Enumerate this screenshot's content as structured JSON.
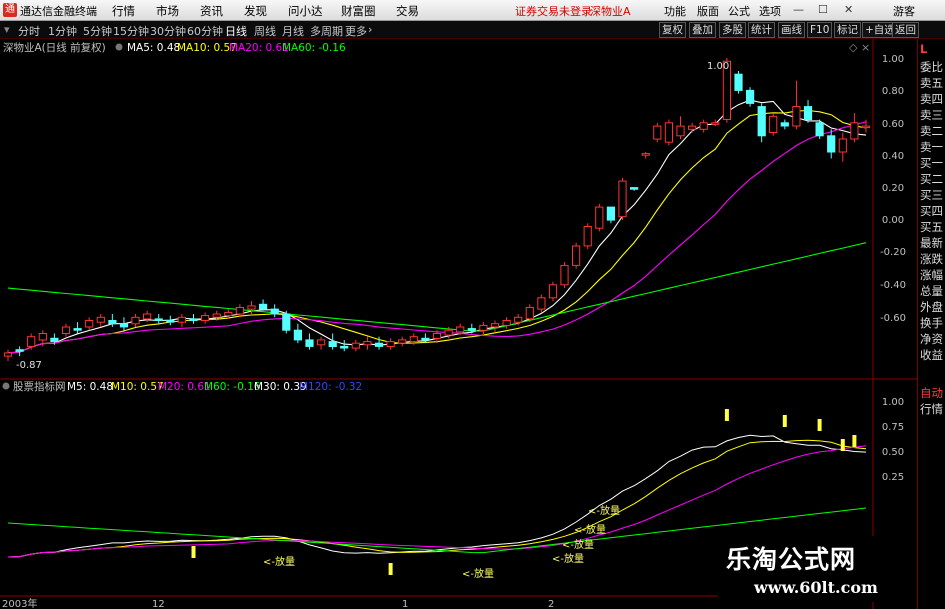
{
  "titlebar": {
    "logo_text": "通",
    "app_name": "通达信金融终端",
    "menus": [
      "行情",
      "市场",
      "资讯",
      "发现",
      "问小达",
      "财富圈",
      "交易"
    ],
    "status_warning": "证券交易未登录",
    "stock_title": "深物业A",
    "tools": [
      "功能",
      "版面",
      "公式",
      "选项"
    ],
    "user": "游客"
  },
  "periodbar": {
    "periods": [
      "分时",
      "1分钟",
      "5分钟",
      "15分钟",
      "30分钟",
      "60分钟",
      "日线",
      "周线",
      "月线",
      "多周期",
      "更多"
    ],
    "active_period": "日线",
    "more_arrow": "›",
    "buttons": [
      "复权",
      "叠加",
      "多股",
      "统计",
      "画线",
      "F10",
      "标记",
      "+自选",
      "返回"
    ]
  },
  "main_chart": {
    "title": "深物业A(日线 前复权)",
    "indicators": [
      {
        "label": "MA5: 0.48",
        "color": "#ffffff"
      },
      {
        "label": "MA10: 0.57",
        "color": "#ffff00"
      },
      {
        "label": "MA20: 0.61",
        "color": "#ff00ff"
      },
      {
        "label": "MA60: -0.16",
        "color": "#00ff00"
      }
    ],
    "y_ticks": [
      "1.00",
      "0.80",
      "0.60",
      "0.40",
      "0.20",
      "0.00",
      "-0.20",
      "-0.40",
      "-0.60"
    ],
    "high_label": "1.00",
    "low_label": "-0.87"
  },
  "sub_chart": {
    "title": "股票指标网",
    "indicators": [
      {
        "label": "M5: 0.48",
        "color": "#ffffff"
      },
      {
        "label": "M10: 0.57",
        "color": "#ffff00"
      },
      {
        "label": "M20: 0.61",
        "color": "#ff00ff"
      },
      {
        "label": "M60: -0.16",
        "color": "#00ff00"
      },
      {
        "label": "M30: 0.39",
        "color": "#ffffff"
      },
      {
        "label": "M120: -0.32",
        "color": "#3344ff"
      }
    ],
    "y_ticks": [
      "1.00",
      "0.75",
      "0.50",
      "0.25"
    ],
    "volume_labels": [
      "<-放量",
      "<-放量",
      "<-放量",
      "<-放量",
      "<-放量",
      "<-放量"
    ]
  },
  "x_axis": {
    "labels": [
      "2003年",
      "12",
      "1",
      "2"
    ]
  },
  "sidepanel": {
    "items": [
      "L",
      "委比",
      "卖五",
      "卖四",
      "卖三",
      "卖二",
      "卖一",
      "买一",
      "买二",
      "买三",
      "买四",
      "买五",
      "最新",
      "涨跌",
      "涨幅",
      "总量",
      "外盘",
      "换手",
      "净资",
      "收益",
      "自动",
      "行情"
    ]
  },
  "watermark": {
    "text": "乐淘公式网",
    "url": "www.60lt.com"
  },
  "colors": {
    "up": "#ff3333",
    "down": "#54ffff",
    "ma5": "#ffffff",
    "ma10": "#ffff00",
    "ma20": "#ff00ff",
    "ma60": "#00ff00",
    "axis": "#8b0000",
    "text": "#c0c0c0"
  },
  "chart_data": {
    "type": "candlestick",
    "y_range": [
      -0.87,
      1.0
    ],
    "candles_ohlc": [
      [
        -0.84,
        -0.8,
        -0.87,
        -0.82
      ],
      [
        -0.8,
        -0.78,
        -0.84,
        -0.81
      ],
      [
        -0.78,
        -0.7,
        -0.8,
        -0.72
      ],
      [
        -0.74,
        -0.68,
        -0.78,
        -0.7
      ],
      [
        -0.73,
        -0.7,
        -0.77,
        -0.75
      ],
      [
        -0.7,
        -0.64,
        -0.72,
        -0.66
      ],
      [
        -0.67,
        -0.63,
        -0.7,
        -0.68
      ],
      [
        -0.66,
        -0.6,
        -0.68,
        -0.62
      ],
      [
        -0.63,
        -0.58,
        -0.66,
        -0.6
      ],
      [
        -0.62,
        -0.58,
        -0.66,
        -0.64
      ],
      [
        -0.64,
        -0.6,
        -0.69,
        -0.66
      ],
      [
        -0.64,
        -0.58,
        -0.66,
        -0.6
      ],
      [
        -0.61,
        -0.56,
        -0.63,
        -0.58
      ],
      [
        -0.61,
        -0.58,
        -0.64,
        -0.62
      ],
      [
        -0.62,
        -0.59,
        -0.65,
        -0.63
      ],
      [
        -0.63,
        -0.58,
        -0.66,
        -0.6
      ],
      [
        -0.61,
        -0.58,
        -0.64,
        -0.62
      ],
      [
        -0.62,
        -0.57,
        -0.64,
        -0.59
      ],
      [
        -0.6,
        -0.56,
        -0.62,
        -0.58
      ],
      [
        -0.59,
        -0.55,
        -0.61,
        -0.57
      ],
      [
        -0.58,
        -0.52,
        -0.6,
        -0.54
      ],
      [
        -0.55,
        -0.5,
        -0.58,
        -0.53
      ],
      [
        -0.52,
        -0.49,
        -0.56,
        -0.55
      ],
      [
        -0.55,
        -0.52,
        -0.6,
        -0.58
      ],
      [
        -0.58,
        -0.56,
        -0.7,
        -0.68
      ],
      [
        -0.68,
        -0.64,
        -0.76,
        -0.74
      ],
      [
        -0.74,
        -0.7,
        -0.8,
        -0.78
      ],
      [
        -0.77,
        -0.72,
        -0.8,
        -0.74
      ],
      [
        -0.75,
        -0.7,
        -0.8,
        -0.78
      ],
      [
        -0.78,
        -0.74,
        -0.81,
        -0.79
      ],
      [
        -0.79,
        -0.74,
        -0.81,
        -0.76
      ],
      [
        -0.77,
        -0.72,
        -0.8,
        -0.75
      ],
      [
        -0.76,
        -0.72,
        -0.8,
        -0.78
      ],
      [
        -0.78,
        -0.73,
        -0.8,
        -0.75
      ],
      [
        -0.76,
        -0.72,
        -0.78,
        -0.74
      ],
      [
        -0.75,
        -0.7,
        -0.77,
        -0.72
      ],
      [
        -0.73,
        -0.7,
        -0.76,
        -0.74
      ],
      [
        -0.73,
        -0.68,
        -0.76,
        -0.7
      ],
      [
        -0.71,
        -0.66,
        -0.73,
        -0.68
      ],
      [
        -0.69,
        -0.64,
        -0.71,
        -0.66
      ],
      [
        -0.67,
        -0.64,
        -0.7,
        -0.68
      ],
      [
        -0.68,
        -0.63,
        -0.71,
        -0.65
      ],
      [
        -0.66,
        -0.62,
        -0.69,
        -0.64
      ],
      [
        -0.65,
        -0.6,
        -0.67,
        -0.62
      ],
      [
        -0.63,
        -0.58,
        -0.65,
        -0.6
      ],
      [
        -0.61,
        -0.52,
        -0.63,
        -0.54
      ],
      [
        -0.55,
        -0.46,
        -0.57,
        -0.48
      ],
      [
        -0.48,
        -0.38,
        -0.5,
        -0.4
      ],
      [
        -0.4,
        -0.26,
        -0.42,
        -0.28
      ],
      [
        -0.28,
        -0.14,
        -0.3,
        -0.16
      ],
      [
        -0.16,
        -0.02,
        -0.18,
        -0.04
      ],
      [
        -0.05,
        0.1,
        -0.07,
        0.08
      ],
      [
        0.08,
        0.06,
        -0.02,
        0.0
      ],
      [
        0.02,
        0.26,
        0.0,
        0.24
      ],
      [
        0.2,
        0.2,
        0.18,
        0.19
      ],
      [
        0.4,
        0.42,
        0.38,
        0.41
      ],
      [
        0.5,
        0.6,
        0.48,
        0.58
      ],
      [
        0.48,
        0.62,
        0.46,
        0.6
      ],
      [
        0.52,
        0.64,
        0.5,
        0.58
      ],
      [
        0.56,
        0.6,
        0.54,
        0.58
      ],
      [
        0.56,
        0.62,
        0.54,
        0.6
      ],
      [
        0.6,
        0.62,
        0.58,
        0.6
      ],
      [
        0.62,
        1.0,
        0.6,
        0.98
      ],
      [
        0.9,
        0.92,
        0.78,
        0.8
      ],
      [
        0.8,
        0.82,
        0.7,
        0.72
      ],
      [
        0.7,
        0.72,
        0.48,
        0.52
      ],
      [
        0.54,
        0.66,
        0.52,
        0.64
      ],
      [
        0.6,
        0.62,
        0.56,
        0.58
      ],
      [
        0.58,
        0.86,
        0.56,
        0.7
      ],
      [
        0.7,
        0.74,
        0.6,
        0.62
      ],
      [
        0.6,
        0.62,
        0.5,
        0.52
      ],
      [
        0.52,
        0.56,
        0.38,
        0.42
      ],
      [
        0.42,
        0.54,
        0.36,
        0.5
      ],
      [
        0.5,
        0.66,
        0.48,
        0.6
      ],
      [
        0.58,
        0.62,
        0.54,
        0.58
      ]
    ]
  }
}
